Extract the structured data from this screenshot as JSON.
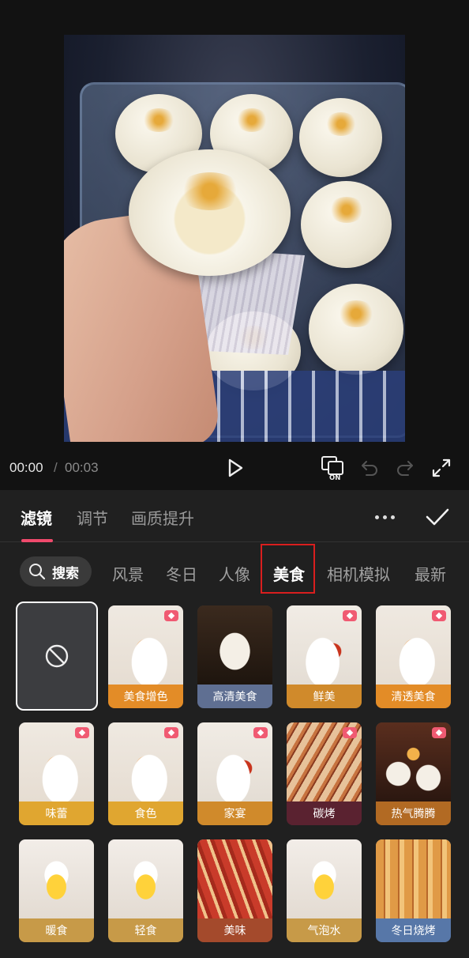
{
  "playback": {
    "current_time": "00:00",
    "separator": "/",
    "total_time": "00:03",
    "original_toggle_badge": "ON"
  },
  "tabs": [
    {
      "label": "滤镜",
      "active": true
    },
    {
      "label": "调节",
      "active": false
    },
    {
      "label": "画质提升",
      "active": false
    }
  ],
  "search": {
    "label": "搜索"
  },
  "categories": [
    {
      "label": "风景",
      "active": false
    },
    {
      "label": "冬日",
      "active": false
    },
    {
      "label": "人像",
      "active": false
    },
    {
      "label": "美食",
      "active": true
    },
    {
      "label": "相机模拟",
      "active": false
    },
    {
      "label": "最新",
      "active": false
    }
  ],
  "filters": [
    {
      "label": "美食增色",
      "icon": "food-photo",
      "premium": true
    },
    {
      "label": "高清美食",
      "icon": "food-photo",
      "premium": false
    },
    {
      "label": "鲜美",
      "icon": "food-photo",
      "premium": true
    },
    {
      "label": "清透美食",
      "icon": "food-photo",
      "premium": true
    },
    {
      "label": "味蕾",
      "icon": "food-photo",
      "premium": true
    },
    {
      "label": "食色",
      "icon": "food-photo",
      "premium": true
    },
    {
      "label": "家宴",
      "icon": "food-photo",
      "premium": true
    },
    {
      "label": "碳烤",
      "icon": "food-photo",
      "premium": true
    },
    {
      "label": "热气腾腾",
      "icon": "food-photo",
      "premium": true
    },
    {
      "label": "暖食",
      "icon": "food-photo",
      "premium": false
    },
    {
      "label": "轻食",
      "icon": "food-photo",
      "premium": false
    },
    {
      "label": "美味",
      "icon": "food-photo",
      "premium": false
    },
    {
      "label": "气泡水",
      "icon": "food-photo",
      "premium": false
    },
    {
      "label": "冬日烧烤",
      "icon": "food-photo",
      "premium": false
    }
  ],
  "colors": {
    "accent": "#f04a6c",
    "highlight_box": "#d91e1e",
    "panel_bg": "#202020"
  }
}
